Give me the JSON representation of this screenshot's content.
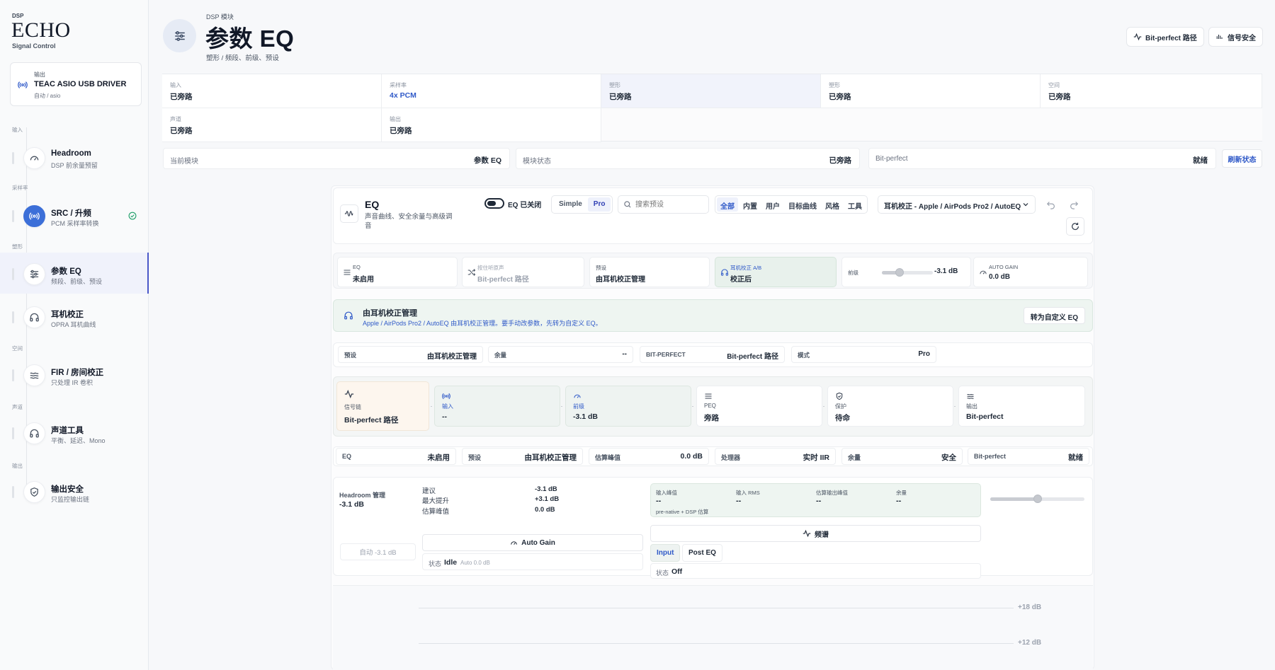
{
  "brand": {
    "kicker": "DSP",
    "name": "ECHO",
    "sub": "Signal Control"
  },
  "output_card": {
    "label": "输出",
    "device": "TEAC ASIO USB DRIVER",
    "mode": "自动 / asio"
  },
  "sidebar": {
    "sections": {
      "input": "输入",
      "samplerate": "采样率",
      "shaping": "塑形",
      "space": "空间",
      "channel": "声道",
      "output": "输出"
    },
    "items": [
      {
        "title": "Headroom",
        "sub": "DSP 前余量预留",
        "icon": "gauge-icon"
      },
      {
        "title": "SRC / 升频",
        "sub": "PCM 采样率转换",
        "icon": "broadcast-icon"
      },
      {
        "title": "参数 EQ",
        "sub": "频段、前级、预设",
        "icon": "sliders-icon"
      },
      {
        "title": "耳机校正",
        "sub": "OPRA 耳机曲线",
        "icon": "headphones-icon"
      },
      {
        "title": "FIR / 房间校正",
        "sub": "只处理 IR 卷积",
        "icon": "waves-icon"
      },
      {
        "title": "声道工具",
        "sub": "平衡、延迟、Mono",
        "icon": "headphones-icon"
      },
      {
        "title": "输出安全",
        "sub": "只监控输出链",
        "icon": "shield-icon"
      }
    ]
  },
  "header": {
    "kicker": "DSP 模块",
    "title": "参数 EQ",
    "sub": "塑形 / 频段、前级、预设",
    "btn_bitperfect": "Bit-perfect 路径",
    "btn_safety": "信号安全"
  },
  "status_grid": [
    {
      "label": "输入",
      "value": "已旁路"
    },
    {
      "label": "采样率",
      "value": "4x PCM"
    },
    {
      "label": "塑形",
      "value": "已旁路"
    },
    {
      "label": "塑形",
      "value": "已旁路"
    },
    {
      "label": "空间",
      "value": "已旁路"
    },
    {
      "label": "声道",
      "value": "已旁路"
    },
    {
      "label": "输出",
      "value": "已旁路"
    }
  ],
  "info_bar": {
    "current_label": "当前模块",
    "current_value": "参数 EQ",
    "state_label": "模块状态",
    "state_value": "已旁路",
    "bp_label": "Bit-perfect",
    "bp_value": "就绪",
    "refresh": "刷新状态"
  },
  "eq": {
    "title": "EQ",
    "desc": "声音曲线、安全余量与高级调音",
    "toggle_label": "EQ 已关闭",
    "mode_simple": "Simple",
    "mode_pro": "Pro",
    "search_placeholder": "搜索预设",
    "categories": [
      "全部",
      "内置",
      "用户",
      "目标曲线",
      "风格",
      "工具"
    ],
    "preset": "耳机校正 - Apple / AirPods Pro2 / AutoEQ"
  },
  "controls": {
    "eq_label": "EQ",
    "eq_value": "未启用",
    "route_label": "按住听原声",
    "route_value": "Bit-perfect 路径",
    "preset_label": "预设",
    "preset_value": "由耳机校正管理",
    "ab_label": "耳机校正 A/B",
    "ab_value": "校正后",
    "preamp_label": "前级",
    "preamp_value": "-3.1 dB",
    "preamp_level": 0.35,
    "autogain_label": "AUTO GAIN",
    "autogain_value": "0.0 dB"
  },
  "banner": {
    "title": "由耳机校正管理",
    "desc": "Apple / AirPods Pro2 / AutoEQ 由耳机校正管理。要手动改参数，先转为自定义 EQ。",
    "button": "转为自定义 EQ"
  },
  "kv": [
    {
      "label": "预设",
      "value": "由耳机校正管理"
    },
    {
      "label": "余量",
      "value": "--"
    },
    {
      "label": "BIT-PERFECT",
      "value": "Bit-perfect 路径"
    },
    {
      "label": "模式",
      "value": "Pro"
    }
  ],
  "chain": {
    "first_label": "信号链",
    "first_value": "Bit-perfect 路径",
    "nodes": [
      {
        "label": "输入",
        "value": "--",
        "icon": "broadcast-icon"
      },
      {
        "label": "前级",
        "value": "-3.1 dB",
        "icon": "gauge-icon"
      },
      {
        "label": "PEQ",
        "value": "旁路",
        "icon": "sliders-icon"
      },
      {
        "label": "保护",
        "value": "待命",
        "icon": "shield-icon"
      },
      {
        "label": "输出",
        "value": "Bit-perfect",
        "icon": "waves-icon"
      }
    ]
  },
  "metrics": [
    {
      "label": "EQ",
      "value": "未启用"
    },
    {
      "label": "预设",
      "value": "由耳机校正管理"
    },
    {
      "label": "估算峰值",
      "value": "0.0 dB"
    },
    {
      "label": "处理器",
      "value": "实时 IIR"
    },
    {
      "label": "余量",
      "value": "安全"
    },
    {
      "label": "Bit-perfect",
      "value": "就绪"
    }
  ],
  "headroom": {
    "title": "Headroom 管理",
    "value": "-3.1 dB",
    "rows": [
      {
        "k": "建议",
        "v": "-3.1 dB"
      },
      {
        "k": "最大提升",
        "v": "+3.1 dB"
      },
      {
        "k": "估算峰值",
        "v": "0.0 dB"
      }
    ],
    "auto_button": "自动 -3.1 dB",
    "autogain_button": "Auto Gain",
    "ag_state_label": "状态",
    "ag_state_value": "Idle",
    "ag_state_extra": "Auto 0.0 dB",
    "meters": [
      {
        "label": "输入峰值",
        "value": "--"
      },
      {
        "label": "输入 RMS",
        "value": "--"
      },
      {
        "label": "估算输出峰值",
        "value": "--"
      },
      {
        "label": "余量",
        "value": "--"
      }
    ],
    "meter_note": "pre-native + DSP 估算",
    "slider_level": 0.5,
    "spectrum_button": "频谱",
    "tab_input": "Input",
    "tab_post": "Post EQ",
    "sp_state_label": "状态",
    "sp_state_value": "Off"
  },
  "graph": {
    "labels": [
      "+18 dB",
      "+12 dB"
    ]
  }
}
